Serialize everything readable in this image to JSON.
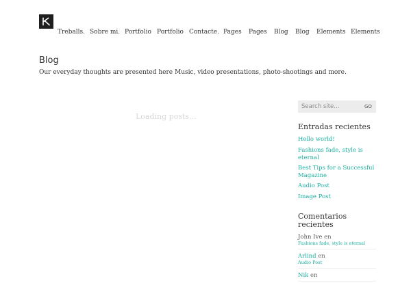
{
  "header": {
    "logo_letter": "K",
    "nav": [
      "Treballs.",
      "Sobre mi.",
      "Portfolio",
      "Portfolio",
      "Contacte.",
      "Pages",
      "Pages",
      "Blog",
      "Blog",
      "Elements",
      "Elements"
    ]
  },
  "main": {
    "title": "Blog",
    "description": "Our everyday thoughts are presented here Music, video presentations, photo-shootings and more.",
    "loading_text": "Loading posts..."
  },
  "sidebar": {
    "search": {
      "placeholder": "Search site...",
      "button_label": "GO"
    },
    "recent_posts": {
      "title": "Entradas recientes",
      "items": [
        "Hello world!",
        "Fashions fade, style is eternal",
        "Best Tips for a Successful Magazine",
        "Audio Post",
        "Image Post"
      ]
    },
    "recent_comments": {
      "title_line1": "Comentarios",
      "title_line2": "recientes",
      "items": [
        {
          "author": "John Ive",
          "on": "en",
          "post": "Fashions fade, style is eternal"
        },
        {
          "author": "Arlind",
          "on": "en",
          "post": "Audio Post"
        },
        {
          "author": "Nik",
          "on": "en",
          "post": ""
        }
      ]
    }
  },
  "colors": {
    "accent": "#1aaf9f",
    "text": "#333333",
    "loading": "#d8d8d8",
    "search_bg": "#ececec",
    "logo_bg": "#1f1f1f"
  },
  "icons": {
    "logo": "k-logo-icon"
  }
}
